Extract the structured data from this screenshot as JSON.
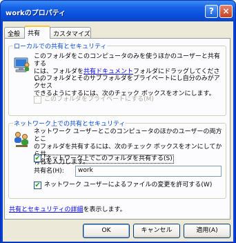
{
  "window": {
    "title": "workのプロパティ",
    "help_label": "?",
    "close_label": "×"
  },
  "tabs": [
    {
      "label": "全般",
      "active": false
    },
    {
      "label": "共有",
      "active": true
    },
    {
      "label": "カスタマイズ",
      "active": false
    }
  ],
  "local_group": {
    "title": "ローカルでの共有とセキュリティ",
    "text1_line1": "このフォルダをこのコンピュータのみを使うほかのユーザーと共有する",
    "text1_line2_pre": "には、フォルダを",
    "text1_link": "共有ドキュメント",
    "text1_line2_post": "フォルダにドラッグしてください。",
    "text2_line1": "このフォルダとそのサブフォルダをプライベートにし自分のみがアクセス",
    "text2_line2": "できるようにするには、次のチェック ボックスをオンにします。",
    "private_checkbox": "このフォルダをプライベートにする(M)",
    "private_checked": false
  },
  "network_group": {
    "title": "ネットワーク上での共有とセキュリティ",
    "text_line1": "ネットワーク ユーザーとこのコンピュータのほかのユーザーの両方とこ",
    "text_line2": "のフォルダを共有するには、次のチェック ボックスをオンにしてから共",
    "text_line3": "有名を入力します。",
    "share_checkbox": "ネットワーク上でこのフォルダを共有する(S)",
    "share_checked": true,
    "share_name_label": "共有名(H):",
    "share_name_value": "work",
    "allow_change_checkbox": "ネットワーク ユーザーによるファイルの変更を許可する(W)",
    "allow_change_checked": true
  },
  "details_link": "共有とセキュリティの詳細",
  "details_suffix": "を表示します。",
  "buttons": {
    "ok": "OK",
    "cancel": "キャンセル",
    "apply": "適用(A)"
  }
}
